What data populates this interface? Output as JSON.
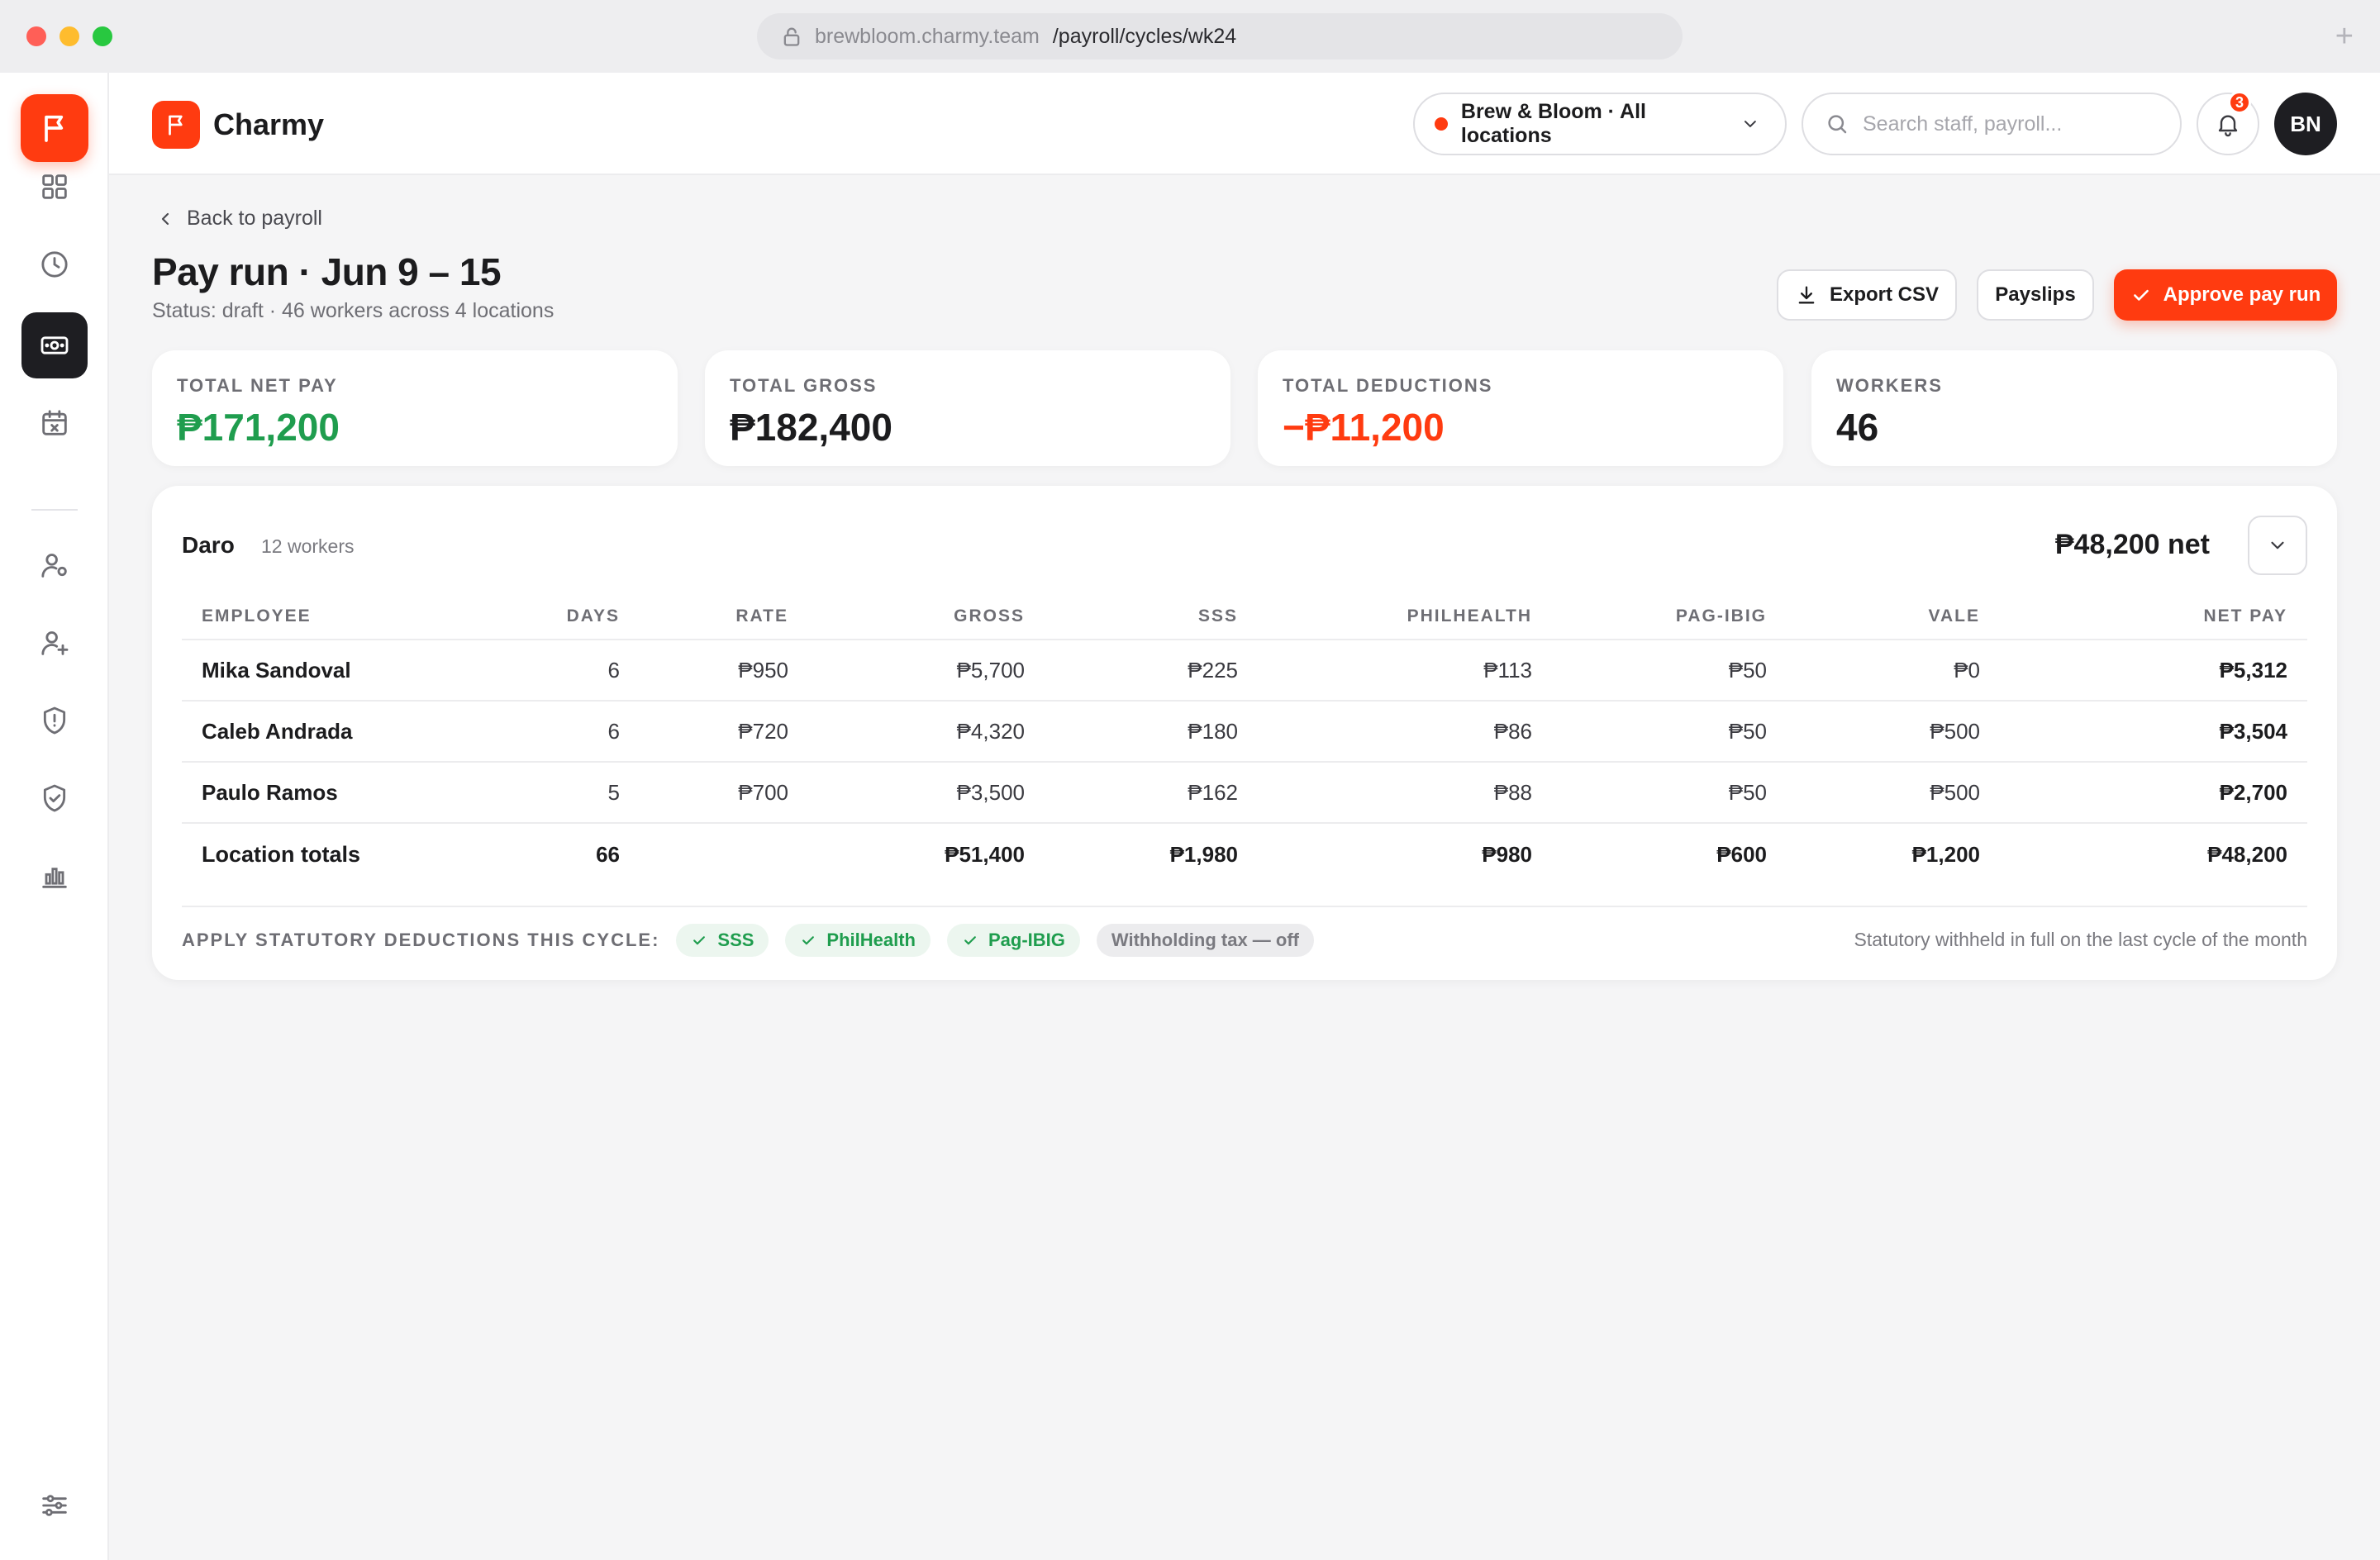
{
  "browser": {
    "url_host": "brewbloom.charmy.team",
    "url_path": "/payroll/cycles/wk24",
    "new_tab": "+"
  },
  "sidebar": {
    "items": [
      {
        "icon": "grid-icon",
        "active": false
      },
      {
        "icon": "clock-icon",
        "active": false
      },
      {
        "icon": "cash-icon",
        "active": true
      },
      {
        "icon": "calendar-x-icon",
        "active": false
      },
      {
        "icon": "user-settings-icon",
        "active": false
      },
      {
        "icon": "user-plus-icon",
        "active": false
      },
      {
        "icon": "shield-alert-icon",
        "active": false
      },
      {
        "icon": "shield-check-icon",
        "active": false
      },
      {
        "icon": "bar-chart-icon",
        "active": false
      }
    ],
    "bottom_icon": "sliders-icon"
  },
  "header": {
    "brand": "Charmy",
    "location_selector": "Brew & Bloom · All locations",
    "search_placeholder": "Search staff, payroll...",
    "notifications_count": "3",
    "avatar_initials": "BN"
  },
  "page": {
    "back_label": "Back to payroll",
    "title": "Pay run · Jun 9 – 15",
    "subtitle": "Status: draft · 46 workers across 4 locations",
    "actions": {
      "export": "Export CSV",
      "payslips": "Payslips",
      "approve": "Approve pay run"
    }
  },
  "stats": [
    {
      "label": "TOTAL NET PAY",
      "value": "₱171,200",
      "tone": "green"
    },
    {
      "label": "TOTAL GROSS",
      "value": "₱182,400",
      "tone": "default"
    },
    {
      "label": "TOTAL DEDUCTIONS",
      "value": "−₱11,200",
      "tone": "red"
    },
    {
      "label": "WORKERS",
      "value": "46",
      "tone": "default"
    }
  ],
  "location": {
    "name": "Daro",
    "count": "12 workers",
    "net": "₱48,200 net",
    "columns": [
      "EMPLOYEE",
      "DAYS",
      "RATE",
      "GROSS",
      "SSS",
      "PHILHEALTH",
      "PAG-IBIG",
      "VALE",
      "NET PAY"
    ],
    "rows": [
      [
        "Mika Sandoval",
        "6",
        "₱950",
        "₱5,700",
        "₱225",
        "₱113",
        "₱50",
        "₱0",
        "₱5,312"
      ],
      [
        "Caleb Andrada",
        "6",
        "₱720",
        "₱4,320",
        "₱180",
        "₱86",
        "₱50",
        "₱500",
        "₱3,504"
      ],
      [
        "Paulo Ramos",
        "5",
        "₱700",
        "₱3,500",
        "₱162",
        "₱88",
        "₱50",
        "₱500",
        "₱2,700"
      ]
    ],
    "totals": [
      "Location totals",
      "66",
      "",
      "₱51,400",
      "₱1,980",
      "₱980",
      "₱600",
      "₱1,200",
      "₱48,200"
    ]
  },
  "deductions": {
    "label": "APPLY STATUTORY DEDUCTIONS THIS CYCLE:",
    "chips": [
      {
        "label": "SSS",
        "on": true
      },
      {
        "label": "PhilHealth",
        "on": true
      },
      {
        "label": "Pag-IBIG",
        "on": true
      },
      {
        "label": "Withholding tax — off",
        "on": false
      }
    ],
    "note": "Statutory withheld in full on the last cycle of the month"
  },
  "colors": {
    "accent": "#ff3b10",
    "positive": "#1f9d4e",
    "dark": "#1e1e22"
  }
}
